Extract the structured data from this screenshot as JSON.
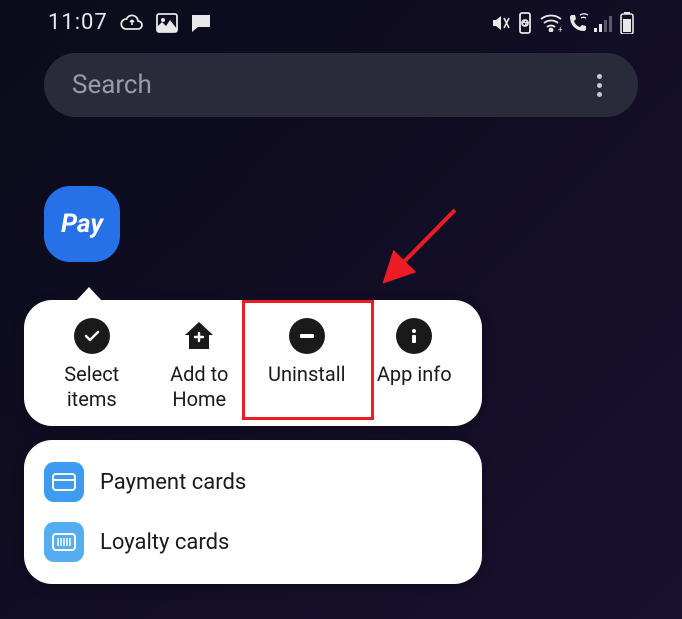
{
  "status": {
    "time": "11:07"
  },
  "search": {
    "placeholder": "Search"
  },
  "app": {
    "label": "Pay"
  },
  "actions": [
    {
      "label": "Select items"
    },
    {
      "label": "Add to Home"
    },
    {
      "label": "Uninstall"
    },
    {
      "label": "App info"
    }
  ],
  "shortcuts": [
    {
      "label": "Payment cards"
    },
    {
      "label": "Loyalty cards"
    }
  ]
}
